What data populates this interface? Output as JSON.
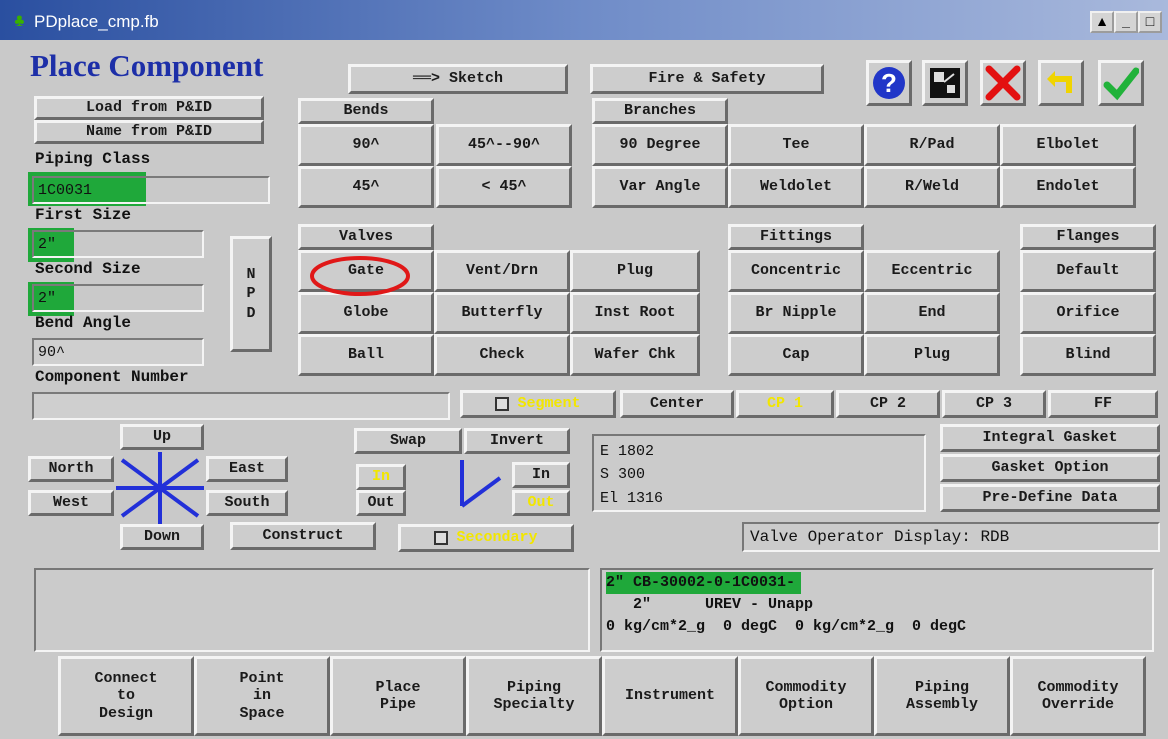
{
  "window": {
    "title": "PDplace_cmp.fb",
    "controls": [
      "▲",
      "_",
      "□",
      "✕"
    ]
  },
  "heading": "Place Component",
  "top_buttons": {
    "sketch": "══> Sketch",
    "fire_safety": "Fire & Safety"
  },
  "left": {
    "load_from_pid": "Load from P&ID",
    "name_from_pid": "Name from P&ID",
    "piping_class_label": "Piping Class",
    "piping_class_value": "1C0031",
    "first_size_label": "First Size",
    "first_size_value": "2\"",
    "second_size_label": "Second Size",
    "second_size_value": "2\"",
    "bend_angle_label": "Bend Angle",
    "bend_angle_value": "90^",
    "npd_button": "N\nP\nD",
    "component_number_label": "Component Number",
    "component_number_value": ""
  },
  "bends": {
    "header": "Bends",
    "b90": "90^",
    "b45_90": "45^--90^",
    "b45": "45^",
    "blt45": "< 45^"
  },
  "branches": {
    "header": "Branches",
    "items": [
      "90 Degree",
      "Tee",
      "R/Pad",
      "Elbolet",
      "Var Angle",
      "Weldolet",
      "R/Weld",
      "Endolet"
    ]
  },
  "valves": {
    "header": "Valves",
    "items": [
      "Gate",
      "Vent/Drn",
      "Plug",
      "Globe",
      "Butterfly",
      "Inst Root",
      "Ball",
      "Check",
      "Wafer Chk"
    ]
  },
  "fittings": {
    "header": "Fittings",
    "items": [
      "Concentric",
      "Eccentric",
      "Br Nipple",
      "End",
      "Cap",
      "Plug"
    ]
  },
  "flanges": {
    "header": "Flanges",
    "items": [
      "Default",
      "Orifice",
      "Blind"
    ]
  },
  "segment_row": {
    "segment": "Segment",
    "center": "Center",
    "cp1": "CP 1",
    "cp2": "CP 2",
    "cp3": "CP 3",
    "ff": "FF"
  },
  "direction": {
    "up": "Up",
    "north": "North",
    "east": "East",
    "west": "West",
    "south": "South",
    "down": "Down",
    "construct": "Construct"
  },
  "orientation": {
    "swap": "Swap",
    "invert": "Invert",
    "in_left": "In",
    "out_left": "Out",
    "in_right": "In",
    "out_right": "Out",
    "secondary": "Secondary"
  },
  "coords": {
    "e": "E 1802",
    "s": "S 300",
    "el": "El 1316"
  },
  "right_buttons": {
    "integral_gasket": "Integral Gasket",
    "gasket_option": "Gasket Option",
    "pre_define": "Pre-Define Data"
  },
  "valve_operator": "Valve Operator Display: RDB",
  "info": {
    "line1": "2\" CB-30002-0-1C0031-",
    "line2": "   2\"      UREV - Unapp",
    "line3": "0 kg/cm*2_g  0 degC  0 kg/cm*2_g  0 degC"
  },
  "bottom_buttons": [
    "Connect\nto\nDesign",
    "Point\nin\nSpace",
    "Place\nPipe",
    "Piping\nSpecialty",
    "Instrument",
    "Commodity\nOption",
    "Piping\nAssembly",
    "Commodity\nOverride"
  ],
  "colors": {
    "highlight": "#1fa83a",
    "yellow_text": "#f2e600",
    "heading": "#1d2fa8"
  }
}
